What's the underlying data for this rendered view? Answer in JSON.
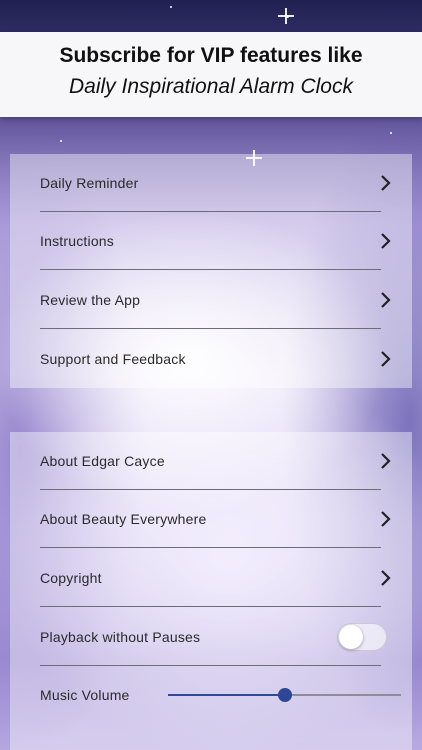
{
  "banner": {
    "line1": "Subscribe for VIP features like",
    "line2": "Daily Inspirational Alarm Clock"
  },
  "group1": {
    "items": [
      {
        "label": "Daily Reminder",
        "icon": "chevron-right-icon"
      },
      {
        "label": "Instructions",
        "icon": "chevron-right-icon"
      },
      {
        "label": "Review the App",
        "icon": "chevron-right-icon"
      },
      {
        "label": "Support and Feedback",
        "icon": "chevron-right-icon"
      }
    ]
  },
  "group2": {
    "items": [
      {
        "label": "About Edgar Cayce",
        "icon": "chevron-right-icon"
      },
      {
        "label": "About Beauty Everywhere",
        "icon": "chevron-right-icon"
      },
      {
        "label": "Copyright",
        "icon": "chevron-right-icon"
      }
    ],
    "playback": {
      "label": "Playback without Pauses",
      "enabled": false
    },
    "volume": {
      "label": "Music Volume",
      "value": 0.5
    }
  },
  "colors": {
    "slider_accent": "#2d4796",
    "text": "#2a2a2a"
  }
}
